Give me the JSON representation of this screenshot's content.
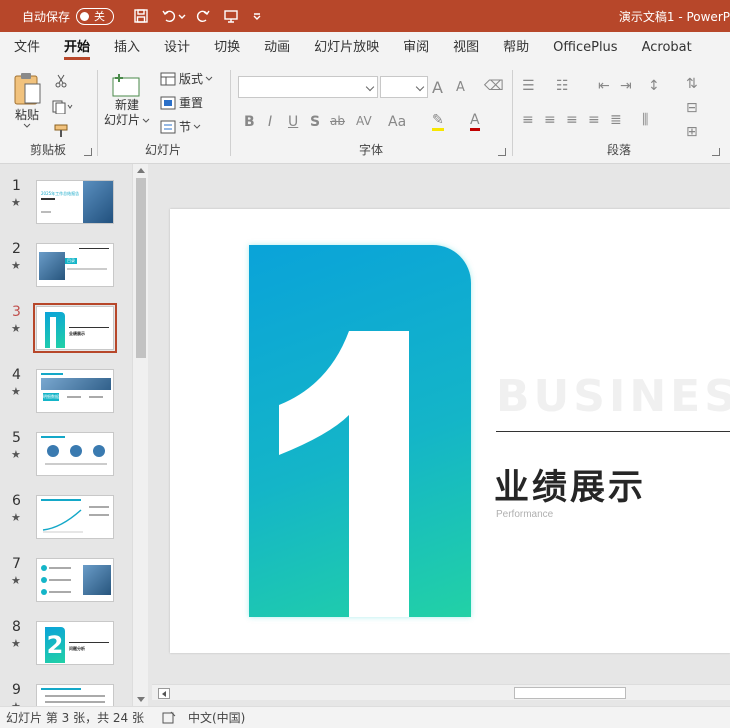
{
  "titlebar": {
    "autosave_label": "自动保存",
    "toggle_state": "关",
    "title_text": "演示文稿1  -  PowerP"
  },
  "tabs": [
    {
      "label": "文件",
      "active": false
    },
    {
      "label": "开始",
      "active": true
    },
    {
      "label": "插入",
      "active": false
    },
    {
      "label": "设计",
      "active": false
    },
    {
      "label": "切换",
      "active": false
    },
    {
      "label": "动画",
      "active": false
    },
    {
      "label": "幻灯片放映",
      "active": false
    },
    {
      "label": "审阅",
      "active": false
    },
    {
      "label": "视图",
      "active": false
    },
    {
      "label": "帮助",
      "active": false
    },
    {
      "label": "OfficePlus",
      "active": false
    },
    {
      "label": "Acrobat",
      "active": false
    }
  ],
  "ribbon": {
    "clipboard": {
      "label": "剪贴板",
      "paste": "粘贴"
    },
    "slides": {
      "label": "幻灯片",
      "new_slide_line1": "新建",
      "new_slide_line2": "幻灯片",
      "layout": "版式",
      "reset": "重置",
      "section": "节"
    },
    "font": {
      "label": "字体",
      "bold": "B",
      "italic": "I",
      "underline": "U",
      "shadow": "S",
      "strike": "ab",
      "spacing": "AV",
      "case": "Aa",
      "grow": "A",
      "shrink": "A"
    },
    "paragraph": {
      "label": "段落"
    }
  },
  "slides_pane": {
    "items": [
      {
        "num": "1",
        "star": "★"
      },
      {
        "num": "2",
        "star": "★"
      },
      {
        "num": "3",
        "star": "★",
        "active": true
      },
      {
        "num": "4",
        "star": "★"
      },
      {
        "num": "5",
        "star": "★"
      },
      {
        "num": "6",
        "star": "★"
      },
      {
        "num": "7",
        "star": "★"
      },
      {
        "num": "8",
        "star": "★"
      },
      {
        "num": "9",
        "star": "★"
      }
    ],
    "thumb_texts": {
      "t1_title": "2025年工作总结报告",
      "t2_label": "目录",
      "t3_title": "业绩展示",
      "t4_label": "明细数据",
      "t8_title": "问题分析"
    }
  },
  "slide": {
    "number": "1",
    "watermark": "BUSINESS",
    "heading": "业绩展示",
    "subheading": "Performance"
  },
  "colors": {
    "accent": "#b7472a",
    "gradient_top": "#0aa3d9",
    "gradient_bottom": "#22d1a6"
  },
  "statusbar": {
    "slide_info": "幻灯片 第 3 张，共 24 张",
    "language": "中文(中国)"
  }
}
